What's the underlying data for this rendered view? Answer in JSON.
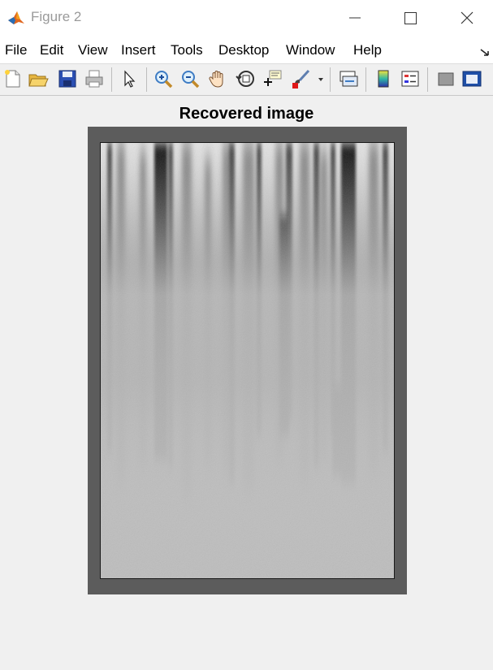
{
  "window": {
    "title": "Figure 2",
    "icon": "matlab-logo-icon",
    "controls": [
      "minimize-icon",
      "maximize-icon",
      "close-icon"
    ]
  },
  "menu": {
    "items": [
      "File",
      "Edit",
      "View",
      "Insert",
      "Tools",
      "Desktop",
      "Window",
      "Help"
    ]
  },
  "toolbar": {
    "buttons": [
      "new-figure-icon",
      "open-file-icon",
      "save-icon",
      "print-icon",
      "pointer-icon",
      "zoom-in-icon",
      "zoom-out-icon",
      "pan-hand-icon",
      "rotate-3d-icon",
      "data-cursor-icon",
      "brush-icon",
      "brush-dropdown-icon",
      "link-plot-icon",
      "colorbar-icon",
      "legend-icon",
      "hide-plot-tools-icon",
      "show-plot-tools-icon"
    ]
  },
  "figure": {
    "axes_title": "Recovered image",
    "image_content": "grayscale-forest-image"
  }
}
